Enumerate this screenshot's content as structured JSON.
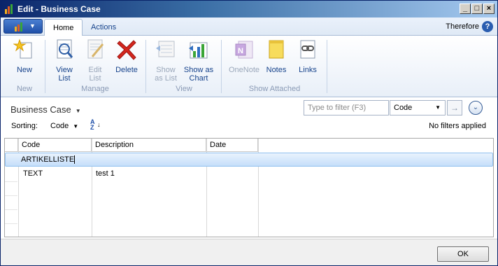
{
  "window": {
    "title": "Edit - Business Case"
  },
  "tabs": [
    {
      "label": "Home"
    },
    {
      "label": "Actions"
    }
  ],
  "company": "Therefore",
  "ribbon": {
    "new": {
      "label": "New",
      "group": "New"
    },
    "manage": {
      "group": "Manage",
      "view_list": "View List",
      "edit_list": "Edit List",
      "delete": "Delete"
    },
    "view": {
      "group": "View",
      "show_as_list": "Show as List",
      "show_as_chart": "Show as Chart"
    },
    "show_attached": {
      "group": "Show Attached",
      "onenote": "OneNote",
      "notes": "Notes",
      "links": "Links"
    }
  },
  "list": {
    "title": "Business Case",
    "filter_placeholder": "Type to filter (F3)",
    "filter_field": "Code",
    "sorting_label": "Sorting:",
    "sorting_field": "Code",
    "filters_status": "No filters applied",
    "columns": [
      "Code",
      "Description",
      "Date"
    ],
    "rows": [
      {
        "code": "ARTIKELLISTE",
        "description": "",
        "date": ""
      },
      {
        "code": "TEXT",
        "description": "test 1",
        "date": ""
      }
    ]
  },
  "footer": {
    "ok_label": "OK"
  },
  "colors": {
    "accent": "#15428b",
    "selection": "#c5defa",
    "title_bar": "#0a246a"
  }
}
